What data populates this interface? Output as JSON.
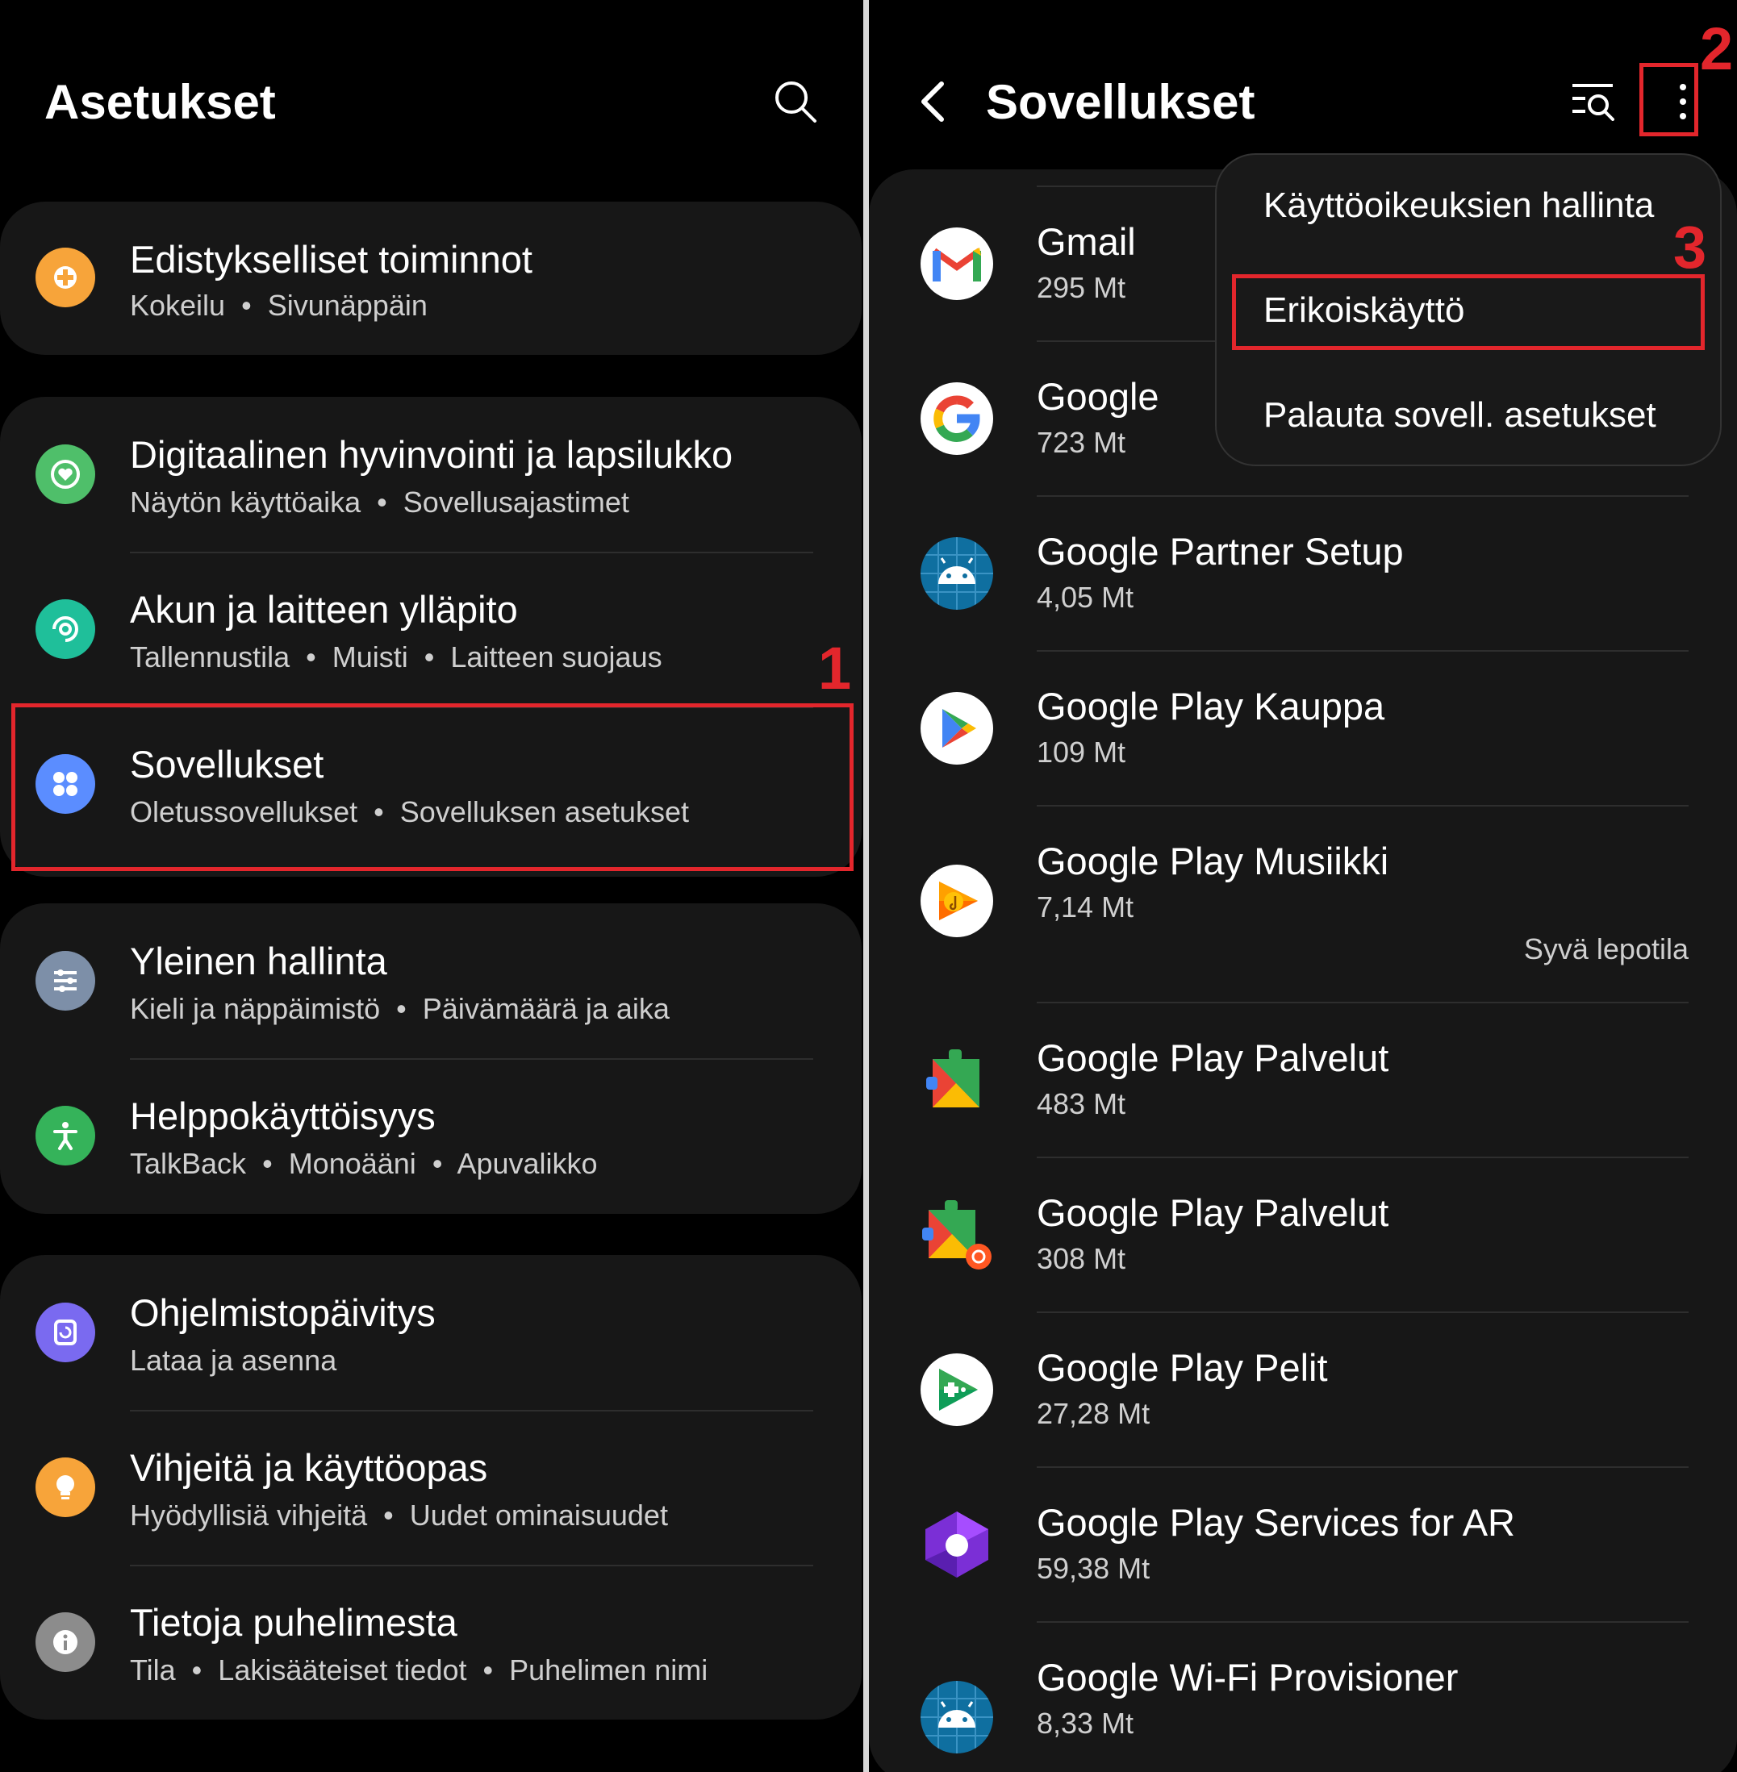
{
  "left": {
    "title": "Asetukset",
    "search_icon": "search-icon",
    "groups": [
      {
        "items": [
          {
            "title": "Edistykselliset toiminnot",
            "sub": [
              "Kokeilu",
              "Sivunäppäin"
            ],
            "icon": "plus-gear-icon",
            "color": "#f7a43a"
          }
        ]
      },
      {
        "items": [
          {
            "title": "Digitaalinen hyvinvointi ja lapsilukko",
            "sub": [
              "Näytön käyttöaika",
              "Sovellusajastimet"
            ],
            "icon": "heart-circle-icon",
            "color": "#4fbf6a"
          },
          {
            "title": "Akun ja laitteen ylläpito",
            "sub": [
              "Tallennustila",
              "Muisti",
              "Laitteen suojaus"
            ],
            "icon": "refresh-circle-icon",
            "color": "#1fbf9a"
          },
          {
            "title": "Sovellukset",
            "sub": [
              "Oletussovellukset",
              "Sovelluksen asetukset"
            ],
            "icon": "apps-grid-icon",
            "color": "#5b8dff"
          }
        ]
      },
      {
        "items": [
          {
            "title": "Yleinen hallinta",
            "sub": [
              "Kieli ja näppäimistö",
              "Päivämäärä ja aika"
            ],
            "icon": "sliders-icon",
            "color": "#7d8fa8"
          },
          {
            "title": "Helppokäyttöisyys",
            "sub": [
              "TalkBack",
              "Monoääni",
              "Apuvalikko"
            ],
            "icon": "accessibility-icon",
            "color": "#35b35a"
          }
        ]
      },
      {
        "items": [
          {
            "title": "Ohjelmistopäivitys",
            "sub": [
              "Lataa ja asenna"
            ],
            "icon": "update-icon",
            "color": "#7a6af0"
          },
          {
            "title": "Vihjeitä ja käyttöopas",
            "sub": [
              "Hyödyllisiä vihjeitä",
              "Uudet ominaisuudet"
            ],
            "icon": "lightbulb-icon",
            "color": "#f7a43a"
          },
          {
            "title": "Tietoja puhelimesta",
            "sub": [
              "Tila",
              "Lakisääteiset tiedot",
              "Puhelimen nimi"
            ],
            "icon": "info-icon",
            "color": "#8c8c8c"
          }
        ]
      }
    ]
  },
  "right": {
    "title": "Sovellukset",
    "back_icon": "back-arrow-icon",
    "filter_icon": "filter-search-icon",
    "more_icon": "more-vertical-icon",
    "apps": [
      {
        "name": "Gmail",
        "size": "295 Mt",
        "icon": "gmail-icon"
      },
      {
        "name": "Google",
        "size": "723 Mt",
        "icon": "google-icon"
      },
      {
        "name": "Google Partner Setup",
        "size": "4,05 Mt",
        "icon": "android-icon"
      },
      {
        "name": "Google Play Kauppa",
        "size": "109 Mt",
        "icon": "play-store-icon"
      },
      {
        "name": "Google Play Musiikki",
        "size": "7,14 Mt",
        "icon": "play-music-icon",
        "status": "Syvä lepotila"
      },
      {
        "name": "Google Play Palvelut",
        "size": "483 Mt",
        "icon": "play-services-icon"
      },
      {
        "name": "Google Play Palvelut",
        "size": "308 Mt",
        "icon": "play-services-icon"
      },
      {
        "name": "Google Play Pelit",
        "size": "27,28 Mt",
        "icon": "play-games-icon"
      },
      {
        "name": "Google Play Services for AR",
        "size": "59,38 Mt",
        "icon": "ar-core-icon"
      },
      {
        "name": "Google Wi-Fi Provisioner",
        "size": "8,33 Mt",
        "icon": "android-icon"
      }
    ],
    "menu": {
      "items": [
        "Käyttöoikeuksien hallinta",
        "Erikoiskäyttö",
        "Palauta sovell. asetukset"
      ]
    }
  },
  "annotations": {
    "one": "1",
    "two": "2",
    "three": "3"
  }
}
